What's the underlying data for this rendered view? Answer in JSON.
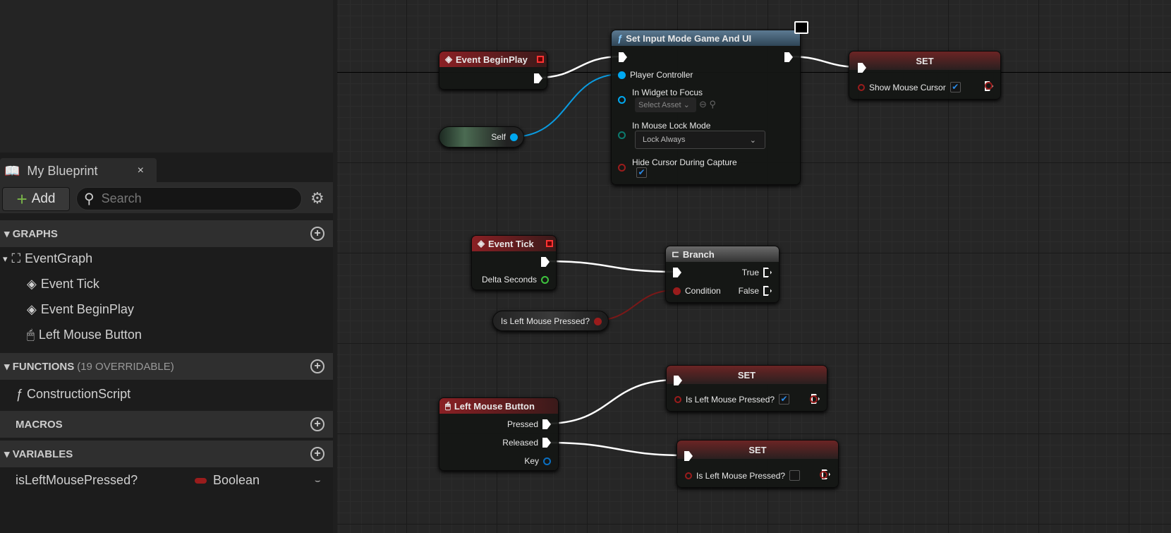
{
  "panel": {
    "tab_title": "My Blueprint",
    "close": "×",
    "add_label": "Add",
    "search_placeholder": "Search",
    "sections": {
      "graphs": "GRAPHS",
      "functions": "FUNCTIONS",
      "functions_sub": "(19 OVERRIDABLE)",
      "macros": "MACROS",
      "variables": "VARIABLES"
    },
    "graphs": [
      "EventGraph",
      "Event Tick",
      "Event BeginPlay",
      "Left Mouse Button"
    ],
    "functions": [
      "ConstructionScript"
    ],
    "variables": [
      {
        "name": "isLeftMousePressed?",
        "type": "Boolean",
        "type_color": "#9a1c1c"
      }
    ]
  },
  "nodes": {
    "begin_play": {
      "title": "Event BeginPlay"
    },
    "self": {
      "label": "Self"
    },
    "set_input": {
      "title": "Set Input Mode Game And UI",
      "pins": [
        "Player Controller",
        "In Widget to Focus",
        "In Mouse Lock Mode",
        "Hide Cursor During Capture"
      ],
      "widget_value": "Select Asset",
      "lock_mode": "Lock Always",
      "hide_cursor": true
    },
    "set1": {
      "title": "SET",
      "pin": "Show Mouse Cursor",
      "value": true
    },
    "event_tick": {
      "title": "Event Tick",
      "pin": "Delta Seconds"
    },
    "branch": {
      "title": "Branch",
      "condition": "Condition",
      "true": "True",
      "false": "False"
    },
    "get_var": {
      "label": "Is Left Mouse Pressed?"
    },
    "set2": {
      "title": "SET",
      "pin": "Is Left Mouse Pressed?",
      "value": true
    },
    "lmb": {
      "title": "Left Mouse Button",
      "pins": [
        "Pressed",
        "Released",
        "Key"
      ]
    },
    "set3": {
      "title": "SET",
      "pin": "Is Left Mouse Pressed?",
      "value": false
    }
  },
  "colors": {
    "exec": "#ffffff",
    "object": "#00a8f0",
    "bool": "#9a1c1c",
    "float": "#3ec43e",
    "enum": "#0c7a6e"
  }
}
